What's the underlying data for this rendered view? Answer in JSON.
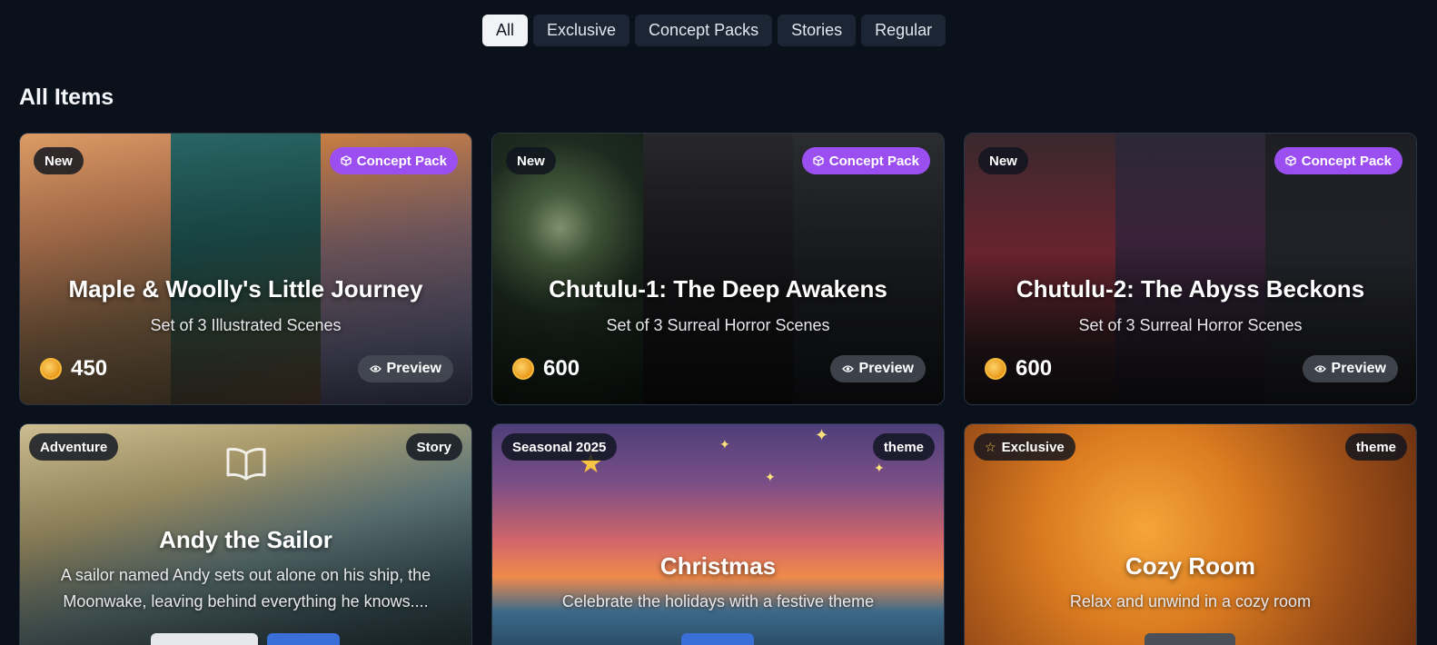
{
  "tabs": [
    {
      "label": "All",
      "active": true
    },
    {
      "label": "Exclusive",
      "active": false
    },
    {
      "label": "Concept Packs",
      "active": false
    },
    {
      "label": "Stories",
      "active": false
    },
    {
      "label": "Regular",
      "active": false
    }
  ],
  "section_title": "All Items",
  "cards": [
    {
      "badge_left": "New",
      "badge_right": "Concept Pack",
      "title": "Maple & Woolly's Little Journey",
      "subtitle": "Set of 3 Illustrated Scenes",
      "price": "450",
      "preview_label": "Preview"
    },
    {
      "badge_left": "New",
      "badge_right": "Concept Pack",
      "title": "Chutulu-1: The Deep Awakens",
      "subtitle": "Set of 3 Surreal Horror Scenes",
      "price": "600",
      "preview_label": "Preview"
    },
    {
      "badge_left": "New",
      "badge_right": "Concept Pack",
      "title": "Chutulu-2: The Abyss Beckons",
      "subtitle": "Set of 3 Surreal Horror Scenes",
      "price": "600",
      "preview_label": "Preview"
    },
    {
      "badge_left": "Adventure",
      "badge_right": "Story",
      "title": "Andy the Sailor",
      "subtitle": "A sailor named Andy sets out alone on his ship, the Moonwake, leaving behind everything he knows...."
    },
    {
      "badge_left": "Seasonal 2025",
      "badge_right": "theme",
      "title": "Christmas",
      "subtitle": "Celebrate the holidays with a festive theme"
    },
    {
      "badge_left": "Exclusive",
      "badge_right": "theme",
      "title": "Cozy Room",
      "subtitle": "Relax and unwind in a cozy room"
    }
  ],
  "icons": {
    "pack": "cube-icon",
    "coin": "coin-icon",
    "preview": "eye-icon",
    "story": "open-book-icon",
    "exclusive": "star-icon"
  },
  "colors": {
    "background": "#0b111a",
    "tab_bg": "#1b2533",
    "tab_active_bg": "#f1f3f6",
    "concept_pack_badge": "#9b4ff0",
    "coin": "#f6b93b"
  }
}
